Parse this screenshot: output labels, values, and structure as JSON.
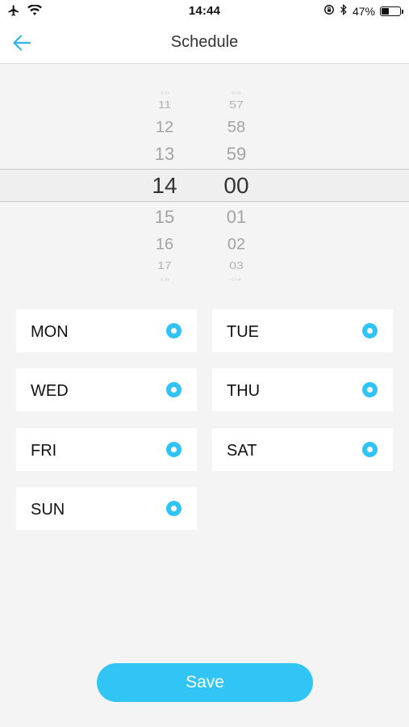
{
  "status_bar": {
    "time": "14:44",
    "battery_text": "47%",
    "battery_level": 0.47,
    "icons": [
      "airplane-icon",
      "wifi-icon",
      "rotation-lock-icon",
      "bluetooth-icon",
      "battery-icon"
    ]
  },
  "header": {
    "title": "Schedule",
    "back_icon": "arrow-left-icon"
  },
  "time_picker": {
    "hours": [
      "10",
      "11",
      "12",
      "13",
      "14",
      "15",
      "16",
      "17",
      "18"
    ],
    "minutes": [
      "56",
      "57",
      "58",
      "59",
      "00",
      "01",
      "02",
      "03",
      "04"
    ],
    "selected_hour": "14",
    "selected_minute": "00"
  },
  "days": [
    {
      "label": "MON",
      "selected": true
    },
    {
      "label": "TUE",
      "selected": true
    },
    {
      "label": "WED",
      "selected": true
    },
    {
      "label": "THU",
      "selected": true
    },
    {
      "label": "FRI",
      "selected": true
    },
    {
      "label": "SAT",
      "selected": true
    },
    {
      "label": "SUN",
      "selected": true
    }
  ],
  "save_label": "Save",
  "colors": {
    "accent": "#31c5f6",
    "background": "#f4f4f4"
  }
}
